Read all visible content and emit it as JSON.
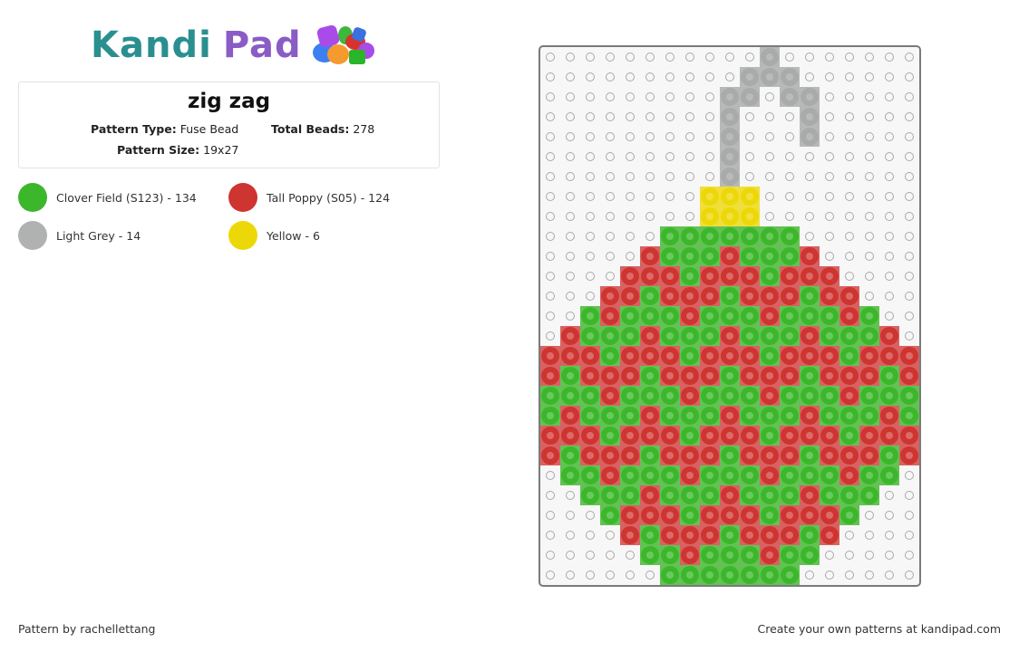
{
  "logo": {
    "part1": "Kandi",
    "part2": "Pad"
  },
  "pattern": {
    "title": "zig zag",
    "type_label": "Pattern Type:",
    "type_value": "Fuse Bead",
    "total_label": "Total Beads:",
    "total_value": "278",
    "size_label": "Pattern Size:",
    "size_value": "19x27"
  },
  "legend": [
    {
      "key": "G",
      "label": "Clover Field (S123) - 134",
      "color": "#3cb72c"
    },
    {
      "key": "R",
      "label": "Tall Poppy (S05) - 124",
      "color": "#ce3430"
    },
    {
      "key": "L",
      "label": "Light Grey - 14",
      "color": "#b0b2b1"
    },
    {
      "key": "Y",
      "label": "Yellow - 6",
      "color": "#ecd808"
    }
  ],
  "board": {
    "columns": 19,
    "rows": 27,
    "grid": [
      "...........L.......",
      "..........LLL......",
      ".........LL.LL.....",
      ".........L...L.....",
      ".........L...L.....",
      ".........L.........",
      ".........L.........",
      "........YYY........",
      "........YYY........",
      "......GGGGGGG......",
      ".....RGGGRGGGR.....",
      "....RRRGRRRGRRR....",
      "...RRGRRRGRRRGRR...",
      "..GRGGGRGGGRGGGRG..",
      ".RGGGRGGGRGGGRGGGR.",
      "RRRGRRRGRRRGRRRGRRR",
      "RGRRRGRRRGRRRGRRRGR",
      "GGGRGGGRGGGRGGGRGGG",
      "GRGGGRGGGRGGGRGGGRG",
      "RRRGRRRGRRRGRRRGRRR",
      "RGRRRGRRRGRRRGRRRGR",
      ".GGRGGGRGGGRGGGRGG.",
      "..GGGRGGGRGGGRGGG..",
      "...GRRRGRRRGRRRG...",
      "....RGRRRGRRRGR....",
      ".....GGRGGGRGG.....",
      "......GGGGGGG......"
    ],
    "colors": {
      "G": {
        "bg": "#63c253",
        "ring": "#3cb72c",
        "hole": "#6ac95c"
      },
      "R": {
        "bg": "#d86262",
        "ring": "#ce3430",
        "hole": "#dd6a68"
      },
      "L": {
        "bg": "#b7b9b8",
        "ring": "#a9abaa",
        "hole": "#b9bbba"
      },
      "Y": {
        "bg": "#f0df3a",
        "ring": "#ecd808",
        "hole": "#f1e03f"
      }
    }
  },
  "footer": {
    "author": "Pattern by rachellettang",
    "cta": "Create your own patterns at kandipad.com"
  }
}
